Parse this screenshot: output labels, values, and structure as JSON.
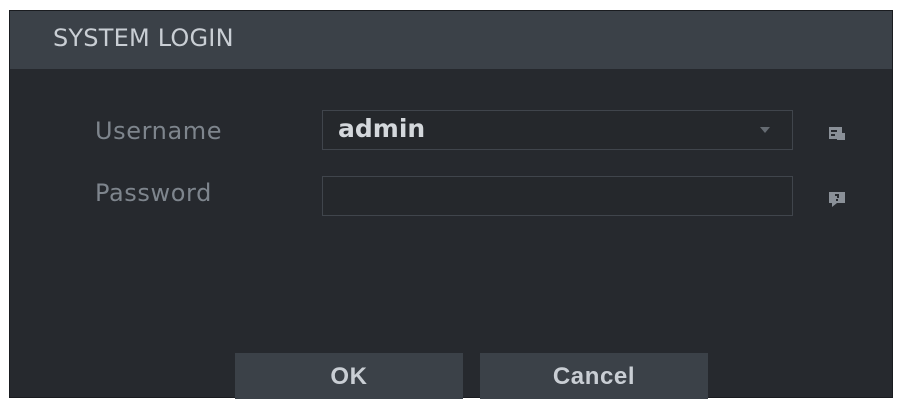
{
  "dialog": {
    "title": "SYSTEM LOGIN"
  },
  "form": {
    "username_label": "Username",
    "username_value": "admin",
    "password_label": "Password",
    "password_value": ""
  },
  "buttons": {
    "ok_label": "OK",
    "cancel_label": "Cancel"
  },
  "icons": {
    "username_side": "keyboard-icon",
    "password_side": "help-icon",
    "username_dropdown": "chevron-down-icon"
  },
  "colors": {
    "dialog_bg": "#26292e",
    "titlebar_bg": "#3b4148",
    "button_bg": "#3b4148",
    "label_text": "#7e858d",
    "value_text": "#d4d8dc"
  }
}
